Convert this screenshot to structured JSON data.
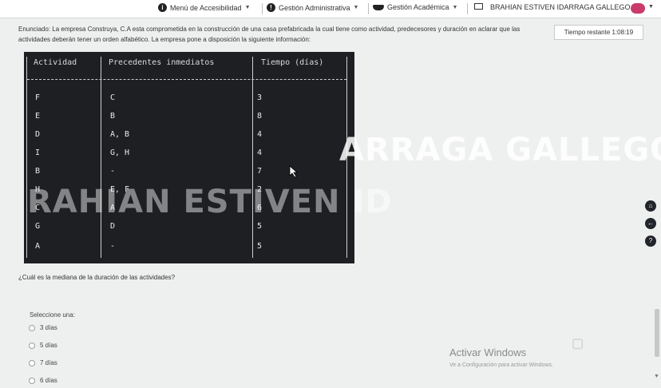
{
  "nav": {
    "accessibility_label": "Menú de Accesibilidad",
    "admin_label": "Gestión Administrativa",
    "academic_label": "Gestión Académica",
    "user_name": "BRAHIAN ESTIVEN IDARRAGA GALLEGO"
  },
  "statement": "Enunciado: La empresa Construya, C.A esta comprometida en la construcción de una casa prefabricada la cual tiene como actividad, predecesores y duración en aclarar que las actividades deberán tener un orden alfabético. La empresa pone a disposición la siguiente información:",
  "timer": "Tiempo restante 1:08:19",
  "table": {
    "headers": [
      "Actividad",
      "Precedentes inmediatos",
      "Tiempo (días)"
    ],
    "rows": [
      [
        "F",
        "C",
        "3"
      ],
      [
        "E",
        "B",
        "8"
      ],
      [
        "D",
        "A, B",
        "4"
      ],
      [
        "I",
        "G, H",
        "4"
      ],
      [
        "B",
        "-",
        "7"
      ],
      [
        "H",
        "E, F",
        "2"
      ],
      [
        "C",
        "A",
        "6"
      ],
      [
        "G",
        "D",
        "5"
      ],
      [
        "A",
        "-",
        "5"
      ]
    ]
  },
  "watermark": {
    "line1": "ARRAGA GALLEGO",
    "line2": "RAHIAN ESTIVEN ID"
  },
  "question": "¿Cuál es la mediana de la duración de las actividades?",
  "select_label": "Seleccione una:",
  "options": [
    "3 días",
    "5 días",
    "7 días",
    "6 días"
  ],
  "windows": {
    "title": "Activar Windows",
    "subtitle": "Ve a Configuración para activar Windows."
  },
  "colors": {
    "avatar": "#c93b6b",
    "table_bg": "#1e1f23"
  }
}
